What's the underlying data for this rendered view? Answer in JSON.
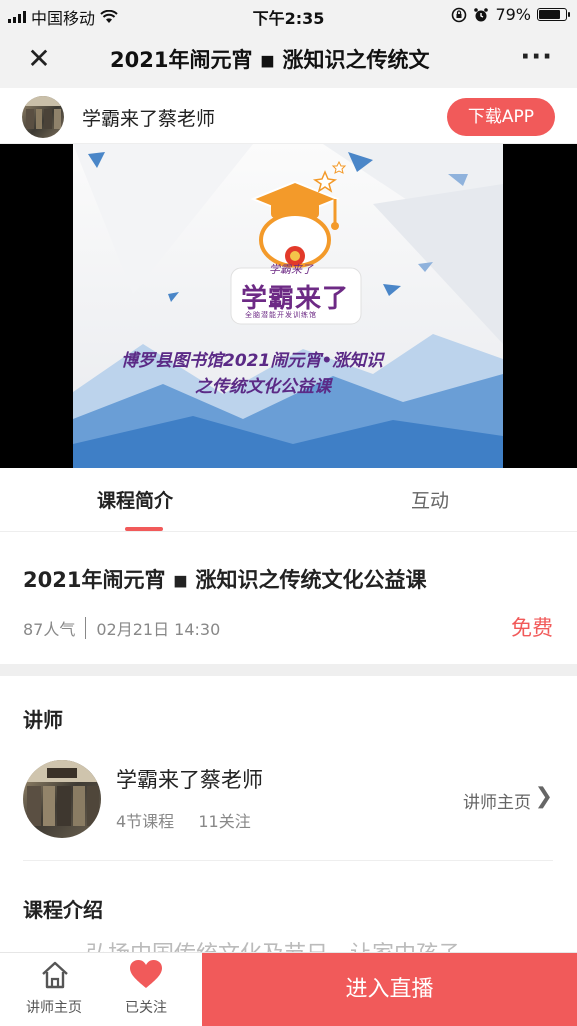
{
  "status_bar": {
    "carrier": "中国移动",
    "time": "下午2:35",
    "battery": "79%",
    "battery_level": 0.79,
    "icons": [
      "signal-icon",
      "wifi-icon",
      "orientation-lock-icon",
      "alarm-icon",
      "battery-icon"
    ]
  },
  "navbar": {
    "title": "2021年闹元宵 ◾ 涨知识之传统文"
  },
  "app_banner": {
    "account_name": "学霸来了蔡老师",
    "download_label": "下载APP"
  },
  "video": {
    "logo_text_small": "学霸来了",
    "logo_text": "学霸来了",
    "logo_slogan": "全脑潜能开发训练馆",
    "caption_line1": "博罗县图书馆2021闹元宵•涨知识",
    "caption_line2": "之传统文化公益课"
  },
  "tabs": [
    {
      "label": "课程简介",
      "active": true
    },
    {
      "label": "互动",
      "active": false
    }
  ],
  "course": {
    "title": "2021年闹元宵 ◾ 涨知识之传统文化公益课",
    "popularity": "87人气",
    "datetime": "02月21日 14:30",
    "price": "免费"
  },
  "lecturer_section": {
    "heading": "讲师",
    "name": "学霸来了蔡老师",
    "courses": "4节课程",
    "followers": "11关注",
    "homepage_link": "讲师主页"
  },
  "intro_section": {
    "heading": "课程介绍",
    "text_partial": "弘扬中国传统文化及节日，让家中孩子"
  },
  "bottom_bar": {
    "home_label": "讲师主页",
    "follow_label": "已关注",
    "enter_live_label": "进入直播"
  },
  "colors": {
    "accent": "#f15a5a",
    "nav_bg": "#f2f2f2",
    "caption_purple": "#5b2a86",
    "mountain_blue": "#4a86c8"
  }
}
